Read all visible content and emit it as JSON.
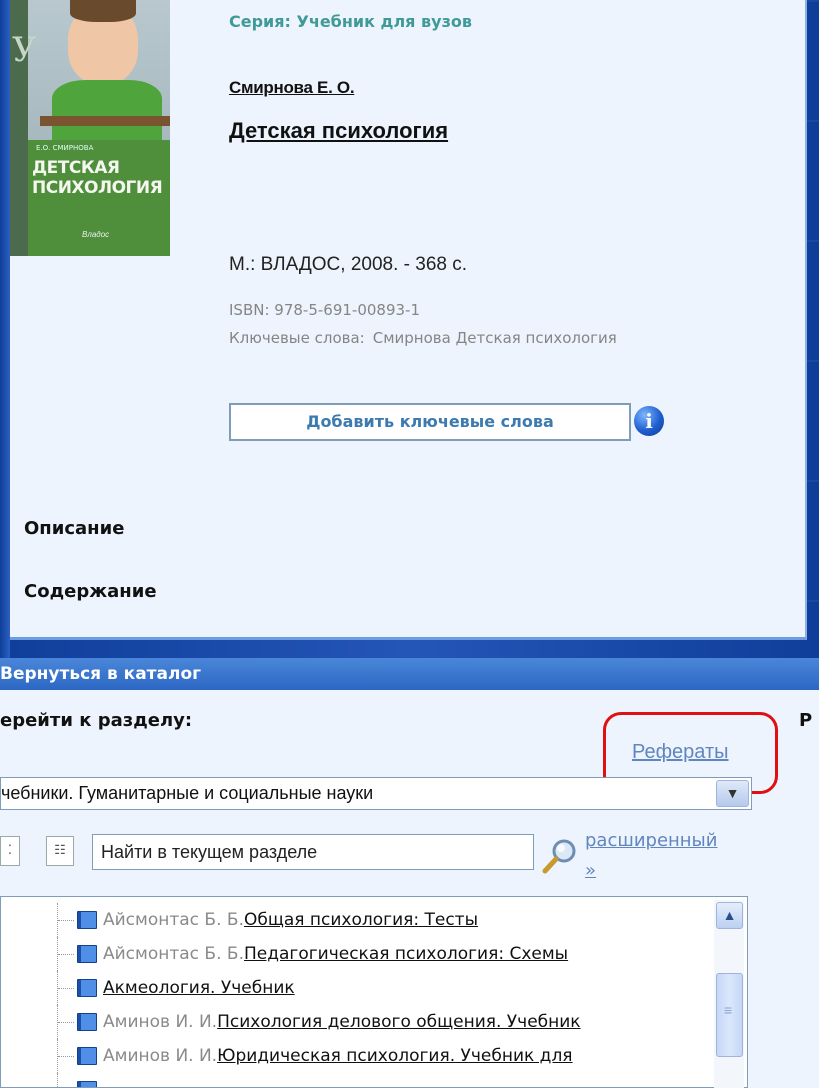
{
  "book": {
    "series": "Серия: Учебник для вузов",
    "author": "Смирнова Е. О.",
    "title": "Детская психология",
    "publisher_info": "М.: ВЛАДОС, 2008. - 368 с.",
    "isbn": "ISBN: 978-5-691-00893-1",
    "keywords_label": "Ключевые слова:",
    "keywords_value": "Смирнова Детская психология",
    "add_keywords_button": "Добавить ключевые слова",
    "info_icon": "i",
    "cover": {
      "logo": "У",
      "small_author": "Е.О. СМИРНОВА",
      "title_line1": "ДЕТСКАЯ",
      "title_line2": "ПСИХОЛОГИЯ",
      "publisher": "Владос"
    }
  },
  "sections": {
    "description": "Описание",
    "contents": "Содержание"
  },
  "catalog": {
    "back_label": "Вернуться в каталог",
    "goto_label": "ерейти к разделу:",
    "right_letter": "Р",
    "referaty_link": "Рефераты",
    "selected_section": "чебники. Гуманитарные и социальные науки",
    "search_value": "Найти в текущем разделе",
    "advanced_link_line1": "расширенный",
    "advanced_link_line2": "»",
    "items": [
      {
        "author": "Айсмонтас Б. Б.",
        "title": "Общая психология: Тесты"
      },
      {
        "author": "Айсмонтас Б. Б.",
        "title": "Педагогическая психология: Схемы"
      },
      {
        "author": "",
        "title": "Акмеология. Учебник"
      },
      {
        "author": "Аминов И. И.",
        "title": "Психология делового общения. Учебник"
      },
      {
        "author": "Аминов И. И.",
        "title": "Юридическая психология. Учебник для"
      }
    ]
  },
  "colors": {
    "desktop_blue": "#1b4ea8",
    "panel_bg": "#eef4fd",
    "series_teal": "#3f9a98",
    "link_blue": "#5f86bf",
    "highlight_red": "#e01010"
  },
  "icons": [
    "search-icon",
    "info-icon",
    "book-icon",
    "chevron-down-icon",
    "chevron-up-icon",
    "tree-collapse-icon",
    "tree-expand-icon"
  ]
}
